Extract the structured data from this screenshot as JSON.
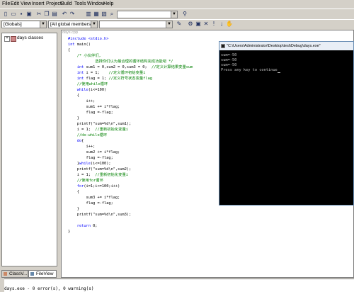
{
  "menu": [
    "File",
    "Edit",
    "View",
    "Insert",
    "Project",
    "Build",
    "Tools",
    "Window",
    "Help"
  ],
  "toolbar": {
    "find_combo_value": "",
    "globals_combo": "[Globals]",
    "members_combo": "[All global members",
    "function_combo": ""
  },
  "workspace": {
    "tree_root": "days classes",
    "tabs": [
      "ClassV...",
      "FileView"
    ]
  },
  "editor": {
    "doc_title": "days.cpp",
    "lines": [
      {
        "indent": "",
        "parts": [
          {
            "t": "#include <stdio.h>",
            "c": "kw"
          }
        ]
      },
      {
        "indent": "",
        "parts": [
          {
            "t": "int",
            "c": "kw"
          },
          {
            "t": " main()",
            "c": ""
          }
        ]
      },
      {
        "indent": "",
        "parts": [
          {
            "t": "{",
            "c": ""
          }
        ]
      },
      {
        "indent": "    ",
        "parts": [
          {
            "t": "/* 小伙伴们,",
            "c": "cm"
          }
        ]
      },
      {
        "indent": "            ",
        "parts": [
          {
            "t": "选择你们认为最合理的循环结构完成功能吧 */",
            "c": "cm"
          }
        ]
      },
      {
        "indent": "    ",
        "parts": [
          {
            "t": "int",
            "c": "kw"
          },
          {
            "t": " sum1 = 0,sum2 = 0,sum3 = 0;  ",
            "c": ""
          },
          {
            "t": "//定义计算结果变量sum",
            "c": "cm"
          }
        ]
      },
      {
        "indent": "    ",
        "parts": [
          {
            "t": "int",
            "c": "kw"
          },
          {
            "t": " i = 1;    ",
            "c": ""
          },
          {
            "t": "//定义循环初始变量i",
            "c": "cm"
          }
        ]
      },
      {
        "indent": "    ",
        "parts": [
          {
            "t": "int",
            "c": "kw"
          },
          {
            "t": " flag = 1; ",
            "c": ""
          },
          {
            "t": "//定义符号状态变量flag",
            "c": "cm"
          }
        ]
      },
      {
        "indent": "    ",
        "parts": [
          {
            "t": "//使用while循环",
            "c": "cm"
          }
        ]
      },
      {
        "indent": "    ",
        "parts": [
          {
            "t": "while",
            "c": "kw"
          },
          {
            "t": "(i<=100)",
            "c": ""
          }
        ]
      },
      {
        "indent": "    ",
        "parts": [
          {
            "t": "{",
            "c": ""
          }
        ]
      },
      {
        "indent": "        ",
        "parts": [
          {
            "t": "i++;",
            "c": ""
          }
        ]
      },
      {
        "indent": "        ",
        "parts": [
          {
            "t": "sum1 += i*flag;",
            "c": ""
          }
        ]
      },
      {
        "indent": "        ",
        "parts": [
          {
            "t": "flag =-flag;",
            "c": ""
          }
        ]
      },
      {
        "indent": "    ",
        "parts": [
          {
            "t": "}",
            "c": ""
          }
        ]
      },
      {
        "indent": "    ",
        "parts": [
          {
            "t": "printf(\"sum=%d\\n\",sum1);",
            "c": ""
          }
        ]
      },
      {
        "indent": "    ",
        "parts": [
          {
            "t": "i = 1;  ",
            "c": ""
          },
          {
            "t": "//重新初始化变量i",
            "c": "cm"
          }
        ]
      },
      {
        "indent": "    ",
        "parts": [
          {
            "t": "//do-while循环",
            "c": "cm"
          }
        ]
      },
      {
        "indent": "    ",
        "parts": [
          {
            "t": "do",
            "c": "kw"
          },
          {
            "t": "{",
            "c": ""
          }
        ]
      },
      {
        "indent": "        ",
        "parts": [
          {
            "t": "i++;",
            "c": ""
          }
        ]
      },
      {
        "indent": "        ",
        "parts": [
          {
            "t": "sum2 += i*flag;",
            "c": ""
          }
        ]
      },
      {
        "indent": "        ",
        "parts": [
          {
            "t": "flag =-flag;",
            "c": ""
          }
        ]
      },
      {
        "indent": "    ",
        "parts": [
          {
            "t": "}",
            "c": ""
          },
          {
            "t": "while",
            "c": "kw"
          },
          {
            "t": "(i<=100);",
            "c": ""
          }
        ]
      },
      {
        "indent": "    ",
        "parts": [
          {
            "t": "printf(\"sum=%d\\n\",sum2);",
            "c": ""
          }
        ]
      },
      {
        "indent": "    ",
        "parts": [
          {
            "t": "i = 1;  ",
            "c": ""
          },
          {
            "t": "//重新初始化变量i",
            "c": "cm"
          }
        ]
      },
      {
        "indent": "    ",
        "parts": [
          {
            "t": "//使用for循环",
            "c": "cm"
          }
        ]
      },
      {
        "indent": "    ",
        "parts": [
          {
            "t": "for",
            "c": "kw"
          },
          {
            "t": "(i=1;i<=100;i++)",
            "c": ""
          }
        ]
      },
      {
        "indent": "    ",
        "parts": [
          {
            "t": "{",
            "c": ""
          }
        ]
      },
      {
        "indent": "        ",
        "parts": [
          {
            "t": "sum3 += i*flag;",
            "c": ""
          }
        ]
      },
      {
        "indent": "        ",
        "parts": [
          {
            "t": "flag =-flag;",
            "c": ""
          }
        ]
      },
      {
        "indent": "    ",
        "parts": [
          {
            "t": "}",
            "c": ""
          }
        ]
      },
      {
        "indent": "    ",
        "parts": [
          {
            "t": "printf(\"sum=%d\\n\",sum3);",
            "c": ""
          }
        ]
      },
      {
        "indent": "",
        "parts": [
          {
            "t": "",
            "c": ""
          }
        ]
      },
      {
        "indent": "    ",
        "parts": [
          {
            "t": "return",
            "c": "kw"
          },
          {
            "t": " 0;",
            "c": ""
          }
        ]
      },
      {
        "indent": "",
        "parts": [
          {
            "t": "}",
            "c": ""
          }
        ]
      }
    ]
  },
  "console": {
    "title": "\"C:\\Users\\Administrator\\Desktop\\test\\Debug\\days.exe\"",
    "lines": [
      "sum=-50",
      "sum=-50",
      "sum=-50",
      "Press any key to continue"
    ]
  },
  "output": {
    "text": "days.exe - 0 error(s), 0 warning(s)"
  },
  "colors": {
    "keyword": "#0000ff",
    "comment": "#008000",
    "console_bg": "#000000"
  }
}
